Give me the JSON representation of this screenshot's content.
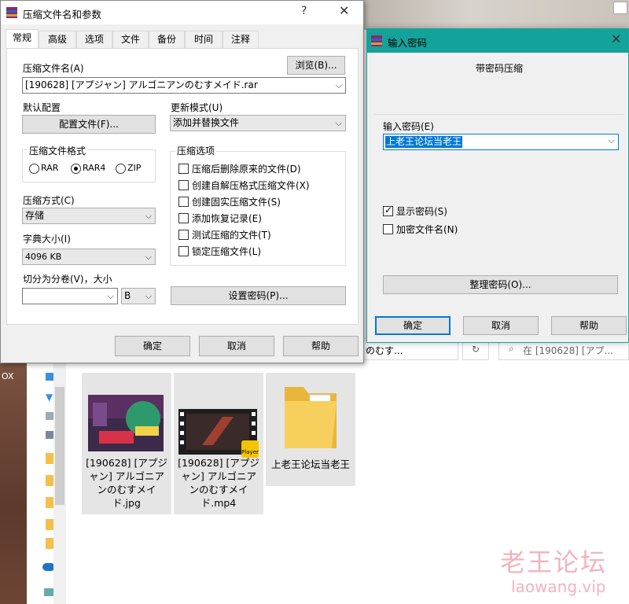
{
  "background": {
    "photo_fragment": "OX"
  },
  "explorer": {
    "address_fragment": "のむす...",
    "search_placeholder": "在 [190628] [アプ...",
    "files": [
      {
        "name": "[190628] [アプジャン] アルゴニアンのむすメイド.jpg",
        "type": "image"
      },
      {
        "name": "[190628] [アプジャン] アルゴニアンのむすメイド.mp4",
        "type": "video",
        "badge": "Player"
      },
      {
        "name": "上老王论坛当老王",
        "type": "folder"
      }
    ]
  },
  "main_dialog": {
    "title": "压缩文件名和参数",
    "help_glyph": "?",
    "close_glyph": "✕",
    "tabs": [
      "常规",
      "高级",
      "选项",
      "文件",
      "备份",
      "时间",
      "注释"
    ],
    "active_tab": 0,
    "archive_name_label": "压缩文件名(A)",
    "browse_button": "浏览(B)...",
    "archive_name_value": "[190628] [アプジャン] アルゴニアンのむすメイド.rar",
    "default_profile_label": "默认配置",
    "profiles_button": "配置文件(F)...",
    "update_mode_label": "更新模式(U)",
    "update_mode_value": "添加并替换文件",
    "format_group_label": "压缩文件格式",
    "formats": [
      {
        "label": "RAR",
        "checked": false
      },
      {
        "label": "RAR4",
        "checked": true
      },
      {
        "label": "ZIP",
        "checked": false
      }
    ],
    "options_group_label": "压缩选项",
    "options": [
      {
        "label": "压缩后删除原来的文件(D)",
        "checked": false
      },
      {
        "label": "创建自解压格式压缩文件(X)",
        "checked": false
      },
      {
        "label": "创建固实压缩文件(S)",
        "checked": false
      },
      {
        "label": "添加恢复记录(E)",
        "checked": false
      },
      {
        "label": "测试压缩的文件(T)",
        "checked": false
      },
      {
        "label": "锁定压缩文件(L)",
        "checked": false
      }
    ],
    "method_label": "压缩方式(C)",
    "method_value": "存储",
    "dict_label": "字典大小(I)",
    "dict_value": "4096 KB",
    "split_label": "切分为分卷(V)，大小",
    "split_value": "",
    "split_unit": "B",
    "set_password_button": "设置密码(P)...",
    "ok_button": "确定",
    "cancel_button": "取消",
    "help_button": "帮助"
  },
  "password_dialog": {
    "title": "输入密码",
    "close_glyph": "✕",
    "heading": "带密码压缩",
    "password_label": "输入密码(E)",
    "password_value": "上老王论坛当老王",
    "show_password_label": "显示密码(S)",
    "show_password_checked": true,
    "encrypt_names_label": "加密文件名(N)",
    "encrypt_names_checked": false,
    "organize_button": "整理密码(O)...",
    "ok_button": "确定",
    "cancel_button": "取消",
    "help_button": "帮助"
  },
  "watermark": {
    "line1": "老王论坛",
    "line2": "laowang.vip"
  }
}
